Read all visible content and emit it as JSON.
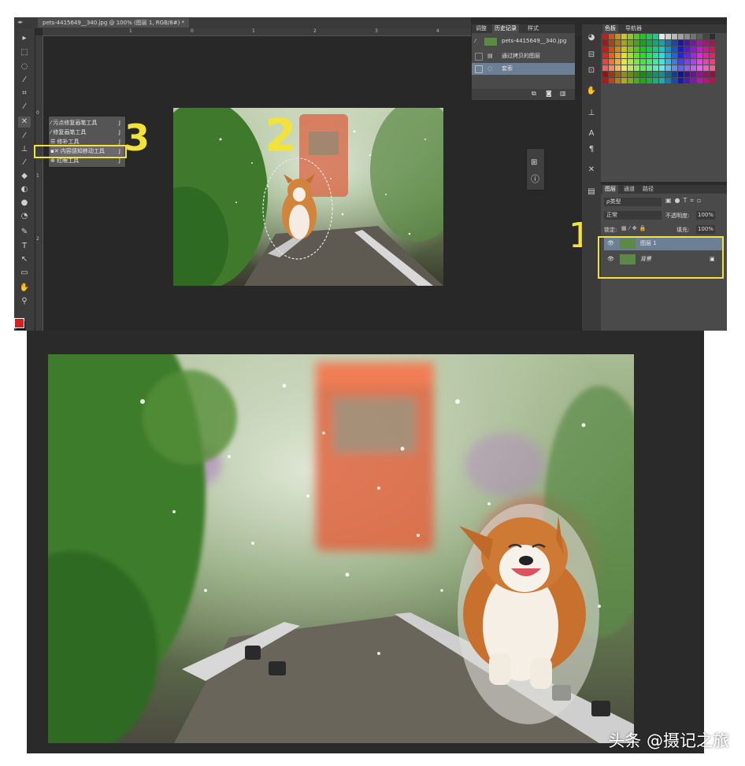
{
  "document_tab": {
    "title": "pets-4415649__340.jpg @ 100% (图层 1, RGB/8#) *"
  },
  "ruler": {
    "top_ticks": [
      "1",
      "0",
      "1",
      "2",
      "3",
      "4"
    ],
    "left_ticks": [
      "0",
      "1",
      "2"
    ]
  },
  "toolbar": {
    "tools": [
      "move-tool",
      "marquee-tool",
      "lasso-tool",
      "quick-select-tool",
      "crop-tool",
      "eyedropper-tool",
      "healing-tool",
      "brush-tool",
      "stamp-tool",
      "history-brush-tool",
      "eraser-tool",
      "gradient-tool",
      "blur-tool",
      "dodge-tool",
      "pen-tool",
      "type-tool",
      "path-select-tool",
      "shape-tool",
      "hand-tool",
      "zoom-tool"
    ],
    "foreground_color": "#d81e1e",
    "background_color": "#000000"
  },
  "flyout": {
    "items": [
      {
        "label": "污点修复画笔工具",
        "key": "J"
      },
      {
        "label": "修复画笔工具",
        "key": "J"
      },
      {
        "label": "修补工具",
        "key": "J"
      },
      {
        "label": "内容感知移动工具",
        "key": "J"
      },
      {
        "label": "红眼工具",
        "key": "J"
      }
    ],
    "selected_index": 3
  },
  "history_panel": {
    "tabs": [
      "调整",
      "历史记录",
      "样式"
    ],
    "active_tab": "历史记录",
    "snapshot": "pets-4415649__340.jpg",
    "steps": [
      "通过拷贝的图层",
      "套索"
    ],
    "active_step": 1
  },
  "swatch_panel": {
    "tabs": [
      "色板",
      "导航器"
    ],
    "active_tab": "色板"
  },
  "layers_panel": {
    "tabs": [
      "图层",
      "通道",
      "路径"
    ],
    "active_tab": "图层",
    "filter": "ρ类型",
    "blend_mode": "正常",
    "opacity_label": "不透明度:",
    "opacity": "100%",
    "lock_label": "锁定:",
    "fill_label": "填充:",
    "fill": "100%",
    "layers": [
      {
        "name": "图层 1",
        "selected": true
      },
      {
        "name": "背景",
        "selected": false,
        "locked": true
      }
    ]
  },
  "annotations": {
    "one": "1",
    "two": "2",
    "three": "3",
    "color": "#f2e23c"
  },
  "watermark": "头条 @摄记之旅"
}
